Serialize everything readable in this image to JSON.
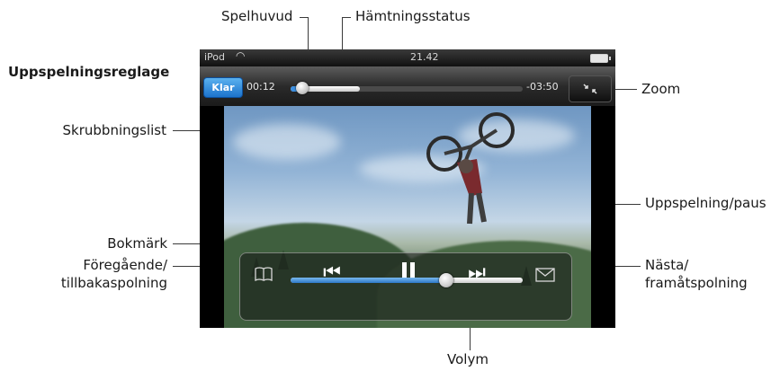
{
  "heading": "Uppspelningsreglage",
  "callouts": {
    "spelhuvud": "Spelhuvud",
    "hamtningsstatus": "Hämtningsstatus",
    "zoom": "Zoom",
    "skrubbningslist": "Skrubbningslist",
    "uppspelning_paus": "Uppspelning/paus",
    "bokmark": "Bokmärk",
    "foregaende_1": "Föregående/",
    "foregaende_2": "tillbakaspolning",
    "nasta_1": "Nästa/",
    "nasta_2": "framåtspolning",
    "volym": "Volym"
  },
  "device": {
    "status_bar": {
      "carrier": "iPod",
      "time": "21.42",
      "wifi_icon": "wifi-icon",
      "battery_icon": "battery-icon"
    },
    "top_bar": {
      "done_label": "Klar",
      "elapsed": "00:12",
      "remaining": "-03:50",
      "playback_fraction": 0.05,
      "download_fraction": 0.3,
      "zoom_icon": "zoom-icon"
    },
    "controls": {
      "bookmark_icon": "bookmark-icon",
      "previous_icon": "previous-rewind-icon",
      "pause_icon": "pause-icon",
      "next_icon": "next-fastforward-icon",
      "email_icon": "email-icon",
      "volume_fraction": 0.67
    },
    "video_subject": "mountain biker mid-air"
  }
}
